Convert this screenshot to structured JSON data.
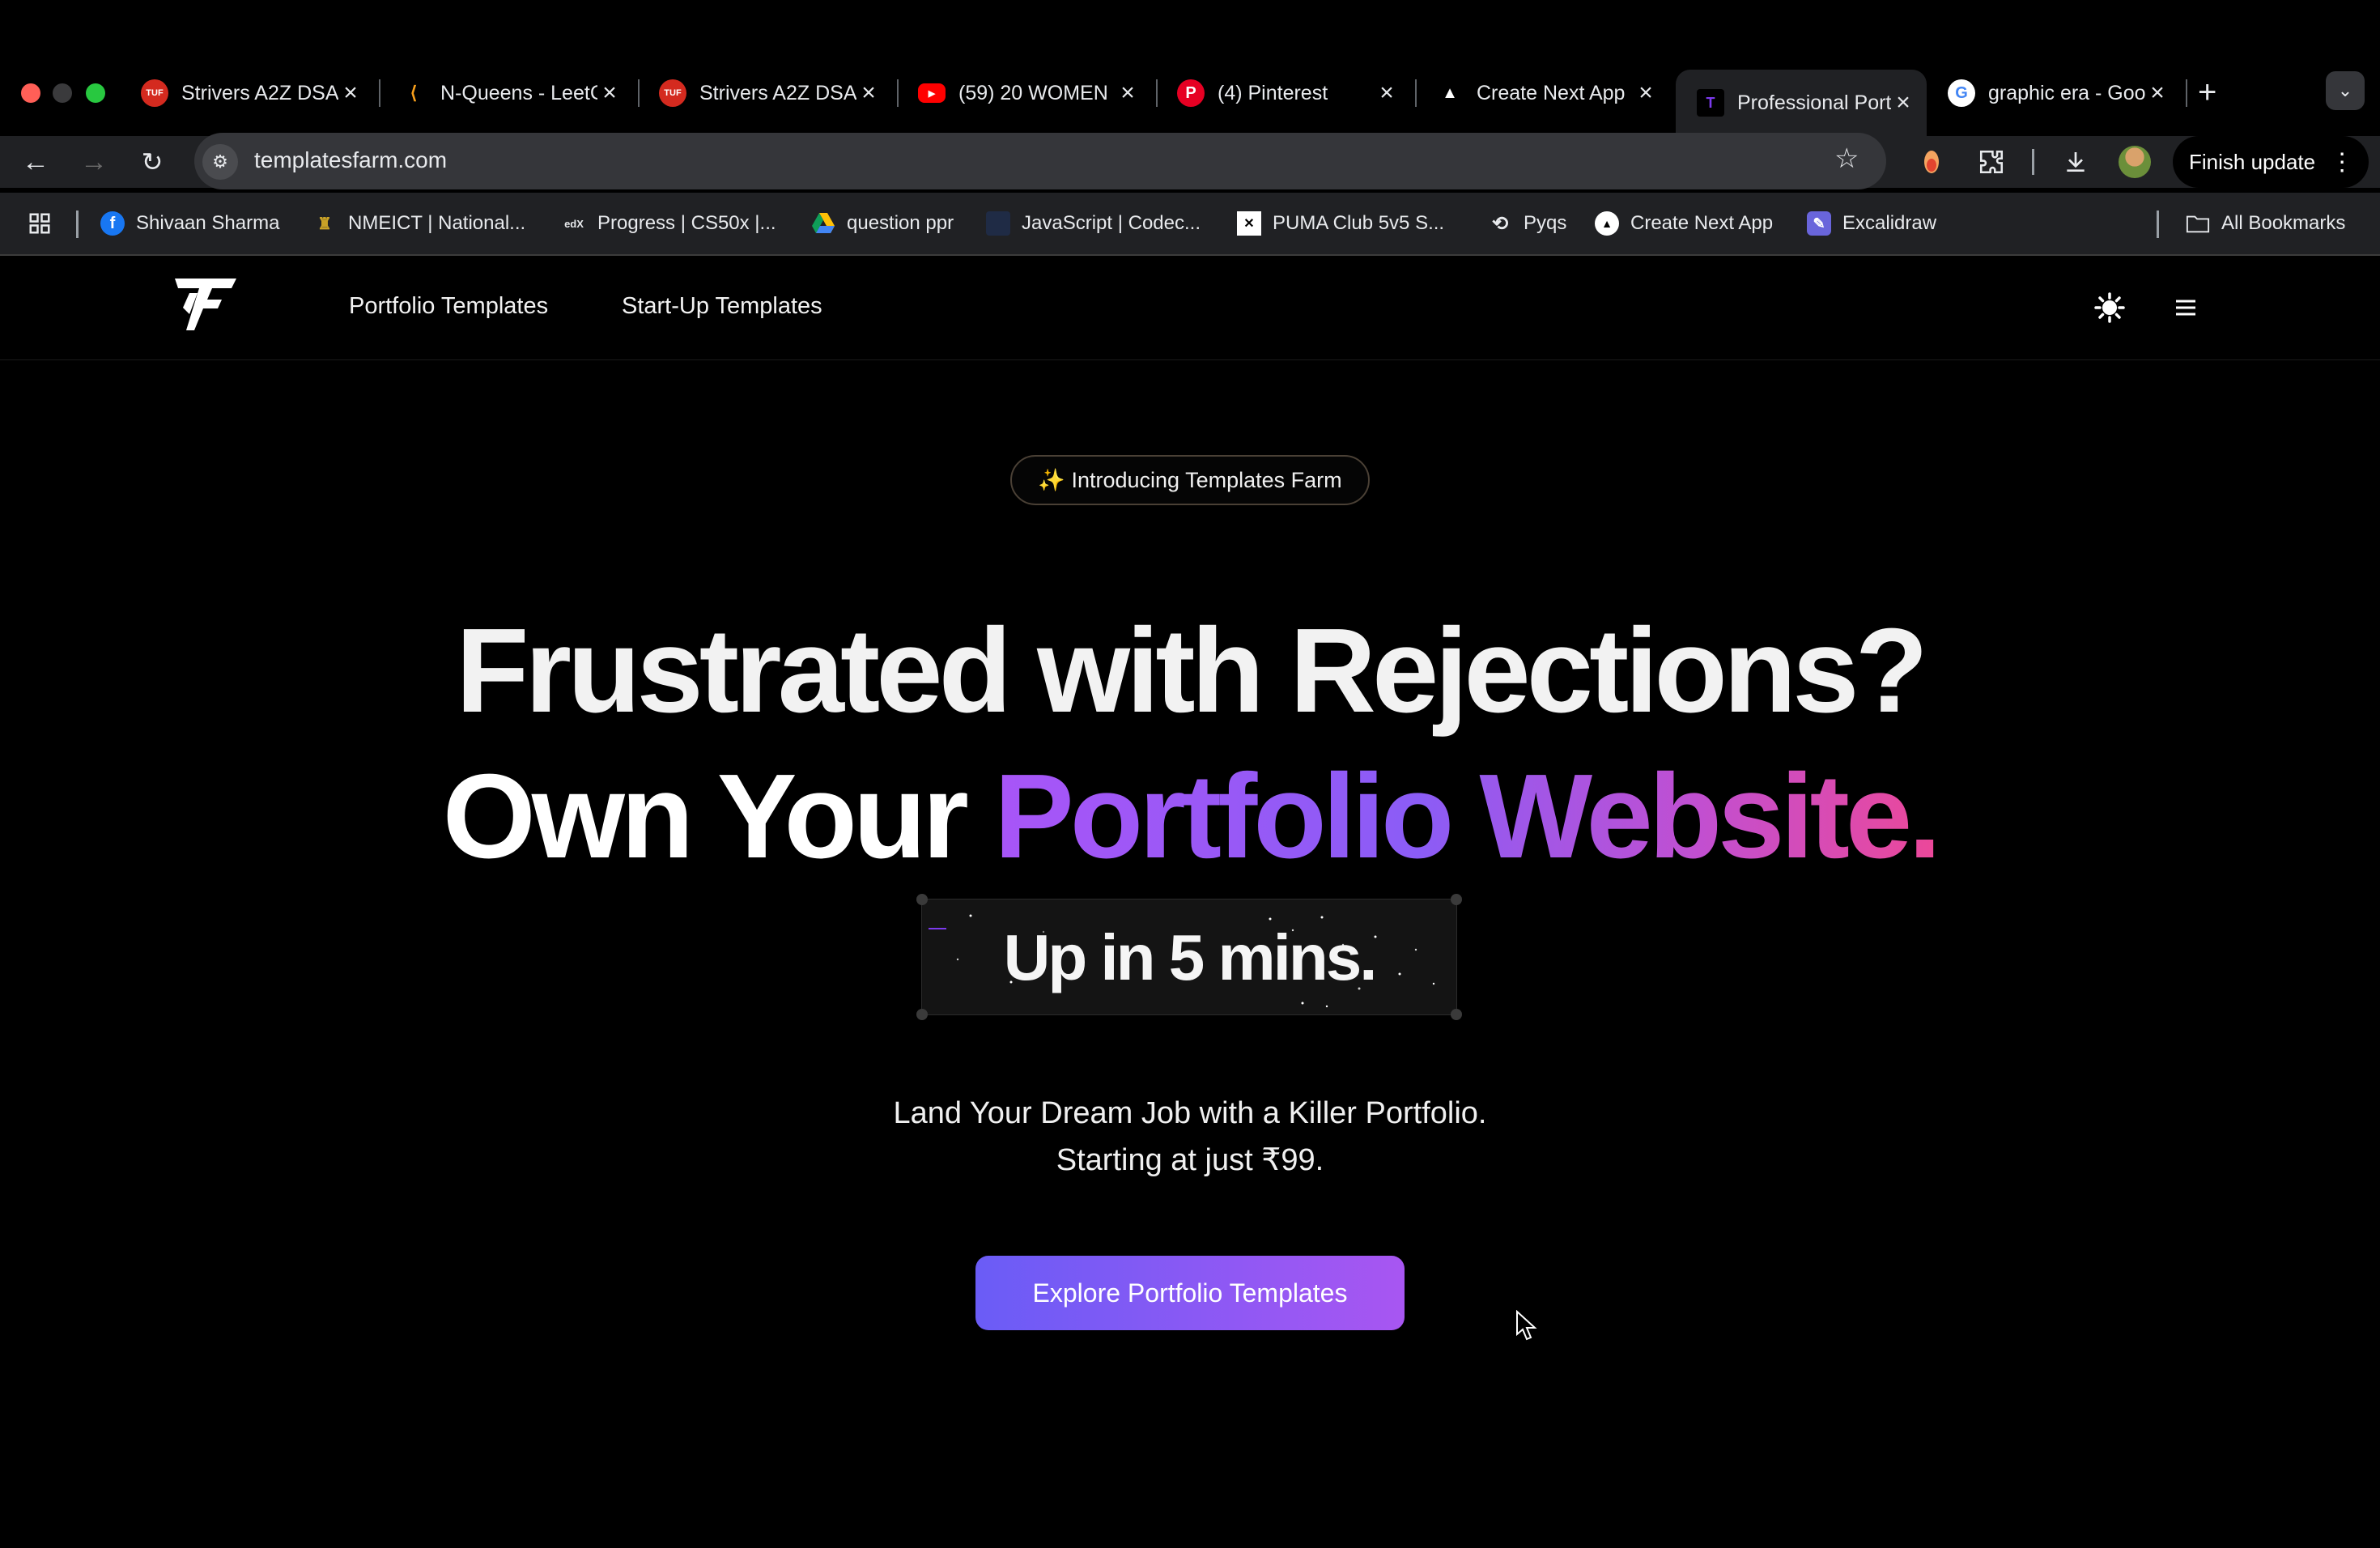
{
  "browser": {
    "tabs": [
      {
        "title": "Strivers A2Z DSA",
        "favicon": "tuf-red"
      },
      {
        "title": "N-Queens - LeetCode",
        "favicon": "leetcode"
      },
      {
        "title": "Strivers A2Z DSA",
        "favicon": "tuf-red"
      },
      {
        "title": "(59) 20 WOMEN",
        "favicon": "youtube"
      },
      {
        "title": "(4) Pinterest",
        "favicon": "pinterest"
      },
      {
        "title": "Create Next App",
        "favicon": "vercel-triangle"
      },
      {
        "title": "Professional Portfolio",
        "favicon": "tf-logo",
        "active": true
      },
      {
        "title": "graphic era - Google",
        "favicon": "google"
      }
    ],
    "new_tab_label": "+",
    "url": "templatesfarm.com",
    "finish_update_label": "Finish update",
    "bookmarks": [
      {
        "label": "Shivaan Sharma",
        "icon": "facebook-icon"
      },
      {
        "label": "NMEICT | National...",
        "icon": "nmeict-icon"
      },
      {
        "label": "Progress | CS50x |...",
        "icon": "edx-icon"
      },
      {
        "label": "question ppr",
        "icon": "drive-icon"
      },
      {
        "label": "JavaScript | Codec...",
        "icon": "codecademy-icon"
      },
      {
        "label": "PUMA Club 5v5 S...",
        "icon": "puma-icon"
      },
      {
        "label": "Pyqs",
        "icon": "link-icon"
      },
      {
        "label": "Create Next App",
        "icon": "vercel-icon"
      },
      {
        "label": "Excalidraw",
        "icon": "excalidraw-icon"
      }
    ],
    "all_bookmarks_label": "All Bookmarks"
  },
  "site": {
    "nav": {
      "portfolio_templates": "Portfolio Templates",
      "startup_templates": "Start-Up Templates"
    },
    "badge": "✨ Introducing Templates Farm",
    "headline_line1": "Frustrated with Rejections?",
    "headline_line2_prefix": "Own Your ",
    "headline_line2_highlight": "Portfolio Website.",
    "highlight_box_text": "Up in 5 mins.",
    "subtitle_line1": "Land Your Dream Job with a Killer Portfolio.",
    "subtitle_line2": "Starting at just ₹99.",
    "cta_label": "Explore Portfolio Templates",
    "colors": {
      "gradient_start": "#a855f7",
      "gradient_end": "#ec4899",
      "cta_start": "#6a5cf6",
      "cta_end": "#a856f2"
    }
  }
}
